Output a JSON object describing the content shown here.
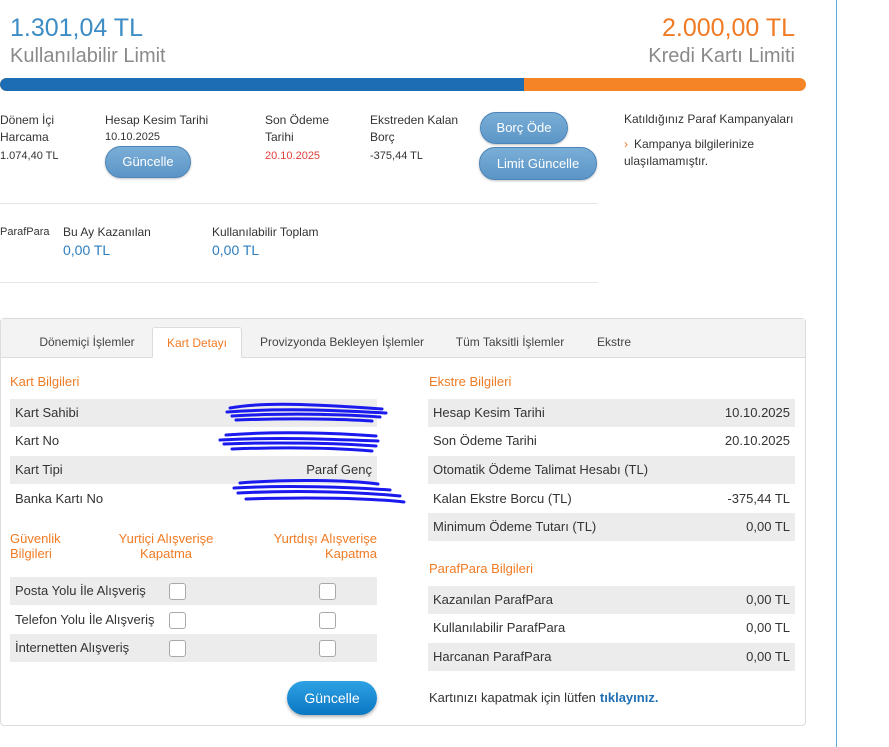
{
  "limits": {
    "available_amount": "1.301,04 TL",
    "available_label": "Kullanılabilir Limit",
    "credit_amount": "2.000,00 TL",
    "credit_label": "Kredi Kartı Limiti",
    "used_fraction": 0.65
  },
  "summary": {
    "period_spend_label": "Dönem İçi Harcama",
    "period_spend_value": "1.074,40 TL",
    "statement_date_label": "Hesap Kesim Tarihi",
    "statement_date_value": "10.10.2025",
    "update_label": "Güncelle",
    "due_date_label": "Son Ödeme Tarihi",
    "due_date_value": "20.10.2025",
    "remaining_label": "Ekstreden Kalan Borç",
    "remaining_value": "-375,44 TL",
    "pay_debt_label": "Borç Öde",
    "limit_update_label": "Limit Güncelle"
  },
  "campaigns": {
    "title": "Katıldığınız Paraf Kampanyaları",
    "chevron": "›",
    "text": "Kampanya bilgilerinize ulaşılamamıştır."
  },
  "parafpara_summary": {
    "label": "ParafPara",
    "earned_label": "Bu Ay Kazanılan",
    "earned_value": "0,00 TL",
    "total_label": "Kullanılabilir Toplam",
    "total_value": "0,00 TL"
  },
  "tabs": [
    {
      "label": "Dönemiçi İşlemler"
    },
    {
      "label": "Kart Detayı"
    },
    {
      "label": "Provizyonda Bekleyen İşlemler"
    },
    {
      "label": "Tüm Taksitli İşlemler"
    },
    {
      "label": "Ekstre"
    }
  ],
  "card_info": {
    "title": "Kart Bilgileri",
    "rows": [
      {
        "label": "Kart Sahibi",
        "value": ""
      },
      {
        "label": "Kart No",
        "value": ""
      },
      {
        "label": "Kart Tipi",
        "value": "Paraf Genç"
      },
      {
        "label": "Banka Kartı No",
        "value": ""
      }
    ]
  },
  "security": {
    "title": "Güvenlik Bilgileri",
    "domestic_header": "Yurtiçi Alışverişe Kapatma",
    "abroad_header": "Yurtdışı Alışverişe Kapatma",
    "rows": [
      {
        "label": "Posta Yolu İle Alışveriş"
      },
      {
        "label": "Telefon Yolu İle Alışveriş"
      },
      {
        "label": "İnternetten Alışveriş"
      }
    ],
    "update_label": "Güncelle"
  },
  "statement_info": {
    "title": "Ekstre Bilgileri",
    "rows": [
      {
        "label": "Hesap Kesim Tarihi",
        "value": "10.10.2025"
      },
      {
        "label": "Son Ödeme Tarihi",
        "value": "20.10.2025"
      },
      {
        "label": "Otomatik Ödeme Talimat Hesabı (TL)",
        "value": ""
      },
      {
        "label": "Kalan Ekstre Borcu (TL)",
        "value": "-375,44 TL"
      },
      {
        "label": "Minimum Ödeme Tutarı (TL)",
        "value": "0,00 TL"
      }
    ]
  },
  "parafpara_info": {
    "title": "ParafPara Bilgileri",
    "rows": [
      {
        "label": "Kazanılan ParafPara",
        "value": "0,00 TL"
      },
      {
        "label": "Kullanılabilir ParafPara",
        "value": "0,00 TL"
      },
      {
        "label": "Harcanan ParafPara",
        "value": "0,00 TL"
      }
    ]
  },
  "close_card": {
    "text": "Kartınızı kapatmak için lütfen",
    "link": "tıklayınız."
  },
  "colors": {
    "accent_orange": "#f07b25",
    "accent_blue": "#1c6db3",
    "scribble_blue": "#1a1aef"
  }
}
